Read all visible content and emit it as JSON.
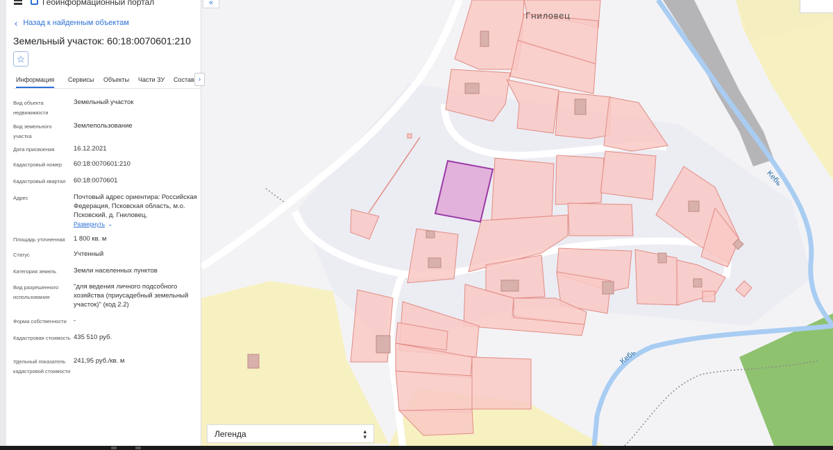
{
  "header": {
    "portal_title": "Геоинформационный портал",
    "back_link": "Назад к найденным объектам",
    "parcel_title": "Земельный участок: 60:18:0070601:210"
  },
  "tabs": [
    {
      "label": "Информация",
      "active": true
    },
    {
      "label": "Сервисы",
      "active": false
    },
    {
      "label": "Объекты",
      "active": false
    },
    {
      "label": "Части ЗУ",
      "active": false
    },
    {
      "label": "Состав",
      "active": false
    }
  ],
  "info": {
    "object_type": {
      "label": "Вид объекта недвижимости",
      "value": "Земельный участок"
    },
    "land_kind": {
      "label": "Вид земельного участка",
      "value": "Землепользование"
    },
    "assign_date": {
      "label": "Дата присвоения",
      "value": "16.12.2021"
    },
    "cadastral_number": {
      "label": "Кадастровый номер",
      "value": "60:18:0070601:210"
    },
    "cadastral_quarter": {
      "label": "Кадастровый квартал",
      "value": "60:18:0070601"
    },
    "address": {
      "label": "Адрес",
      "value": "Почтовый адрес ориентира: Российская Федерация, Псковская область, м.о. Псковский, д. Гниловец,",
      "expand": "Развернуть"
    },
    "area": {
      "label": "Площадь уточненная",
      "value": "1 800 кв. м"
    },
    "status": {
      "label": "Статус",
      "value": "Учтенный"
    },
    "land_category": {
      "label": "Категория земель",
      "value": "Земли населенных пунктов"
    },
    "permitted_use": {
      "label": "Вид разрешенного использования",
      "value": "\"для ведения личного подсобного хозяйства (приусадебный земельный участок)\" (код 2.2)"
    },
    "ownership": {
      "label": "Форма собственности",
      "value": "-"
    },
    "cadastral_value": {
      "label": "Кадастровая стоимость",
      "value": "435 510 руб."
    },
    "specific_value": {
      "label": "Удельный показатель кадастровой стоимости",
      "value": "241,95 руб./кв. м"
    }
  },
  "map": {
    "village_label": "Гниловец",
    "river_label": "Кебь",
    "legend_label": "Легенда",
    "colors": {
      "parcel_fill": "#f9c9c4",
      "parcel_stroke": "#e28b84",
      "selected_fill": "#e2b2dc",
      "selected_stroke": "#9b3aa6",
      "road": "#ffffff",
      "river": "#a9cdf2",
      "forest": "#8fc26f",
      "field": "#f7f1c2",
      "highway": "#b5b5b8"
    }
  },
  "icons": {
    "menu": "menu-icon",
    "logo": "portal-logo-icon",
    "back": "chevron-left-icon",
    "favorite": "star-icon",
    "collapse": "double-chevron-left-icon",
    "tabs_next": "chevron-right-icon",
    "legend_toggle": "up-down-arrows-icon"
  }
}
